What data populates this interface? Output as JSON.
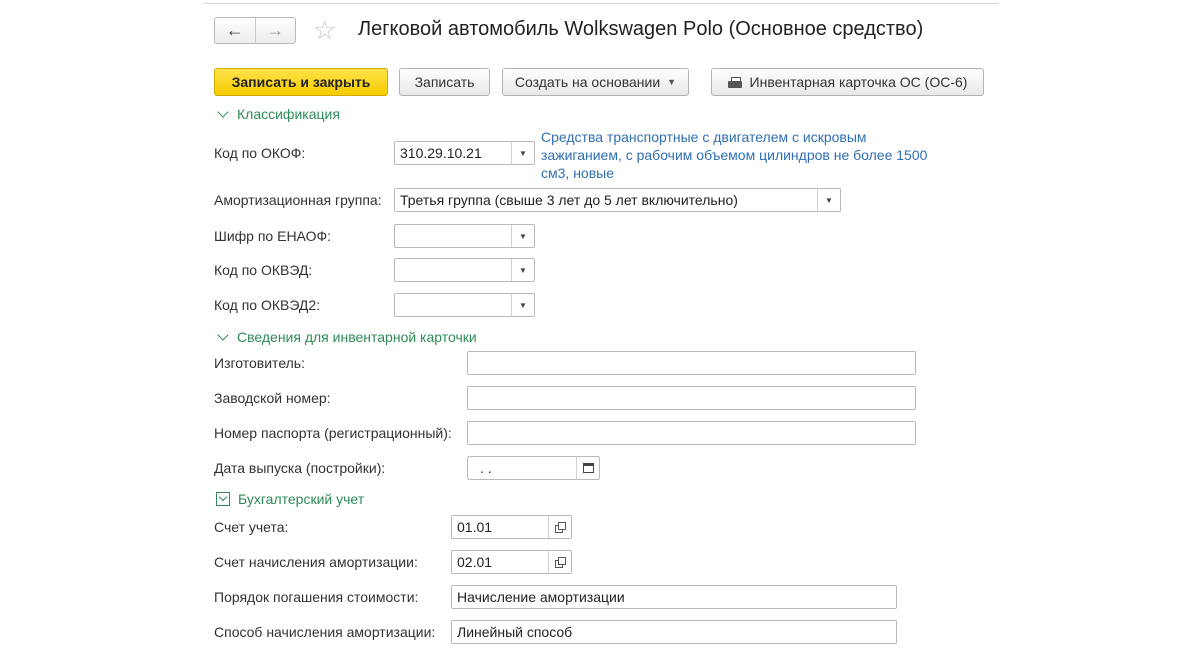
{
  "window": {
    "title": "Легковой автомобиль Wolkswagen Polo (Основное средство)",
    "back_icon": "arrow-left-icon",
    "forward_icon": "arrow-right-icon",
    "favorite_icon": "star-icon"
  },
  "toolbar": {
    "save_close_label": "Записать и закрыть",
    "save_label": "Записать",
    "create_based_label": "Создать на основании",
    "inventory_card_label": "Инвентарная карточка ОС (ОС-6)"
  },
  "classification": {
    "section_label": "Классификация",
    "okof_label": "Код по ОКОФ:",
    "okof_value": "310.29.10.21",
    "okof_description": "Средства транспортные с двигателем с искровым зажиганием, с рабочим объемом цилиндров не более 1500 см3, новые",
    "amort_group_label": "Амортизационная группа:",
    "amort_group_value": "Третья группа (свыше 3 лет до 5 лет включительно)",
    "enaof_label": "Шифр по ЕНАОФ:",
    "enaof_value": "",
    "okved_label": "Код по ОКВЭД:",
    "okved_value": "",
    "okved2_label": "Код по ОКВЭД2:",
    "okved2_value": ""
  },
  "inventory": {
    "section_label": "Сведения для инвентарной карточки",
    "manufacturer_label": "Изготовитель:",
    "manufacturer_value": "",
    "serial_label": "Заводской номер:",
    "serial_value": "",
    "passport_label": "Номер паспорта (регистрационный):",
    "passport_value": "",
    "release_date_label": "Дата выпуска (постройки):",
    "release_date_value": " .  ."
  },
  "accounting": {
    "section_label": "Бухгалтерский учет",
    "account_label": "Счет учета:",
    "account_value": "01.01",
    "amort_account_label": "Счет начисления амортизации:",
    "amort_account_value": "02.01",
    "repayment_label": "Порядок погашения стоимости:",
    "repayment_value": "Начисление амортизации",
    "method_label": "Способ начисления амортизации:",
    "method_value": "Линейный способ"
  }
}
